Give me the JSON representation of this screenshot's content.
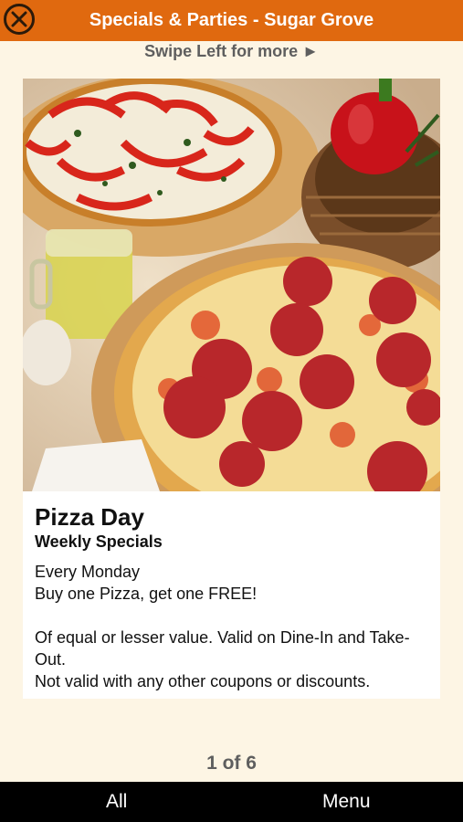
{
  "header": {
    "title": "Specials & Parties - Sugar Grove",
    "close_icon": "close-circle-icon"
  },
  "swipe_hint": "Swipe Left for more ►",
  "special": {
    "image": "pizza-photo",
    "title": "Pizza Day",
    "subtitle": "Weekly Specials",
    "lines": [
      "Every Monday",
      "Buy one Pizza, get one FREE!",
      "",
      "Of equal or lesser value. Valid on Dine-In and Take-Out.",
      "Not valid with any other coupons or discounts."
    ]
  },
  "pager": "1 of 6",
  "tabs": {
    "all": "All",
    "menu": "Menu"
  },
  "colors": {
    "header_bg": "#e0690f",
    "page_bg": "#fdf5e4",
    "tabbar_bg": "#000000"
  }
}
